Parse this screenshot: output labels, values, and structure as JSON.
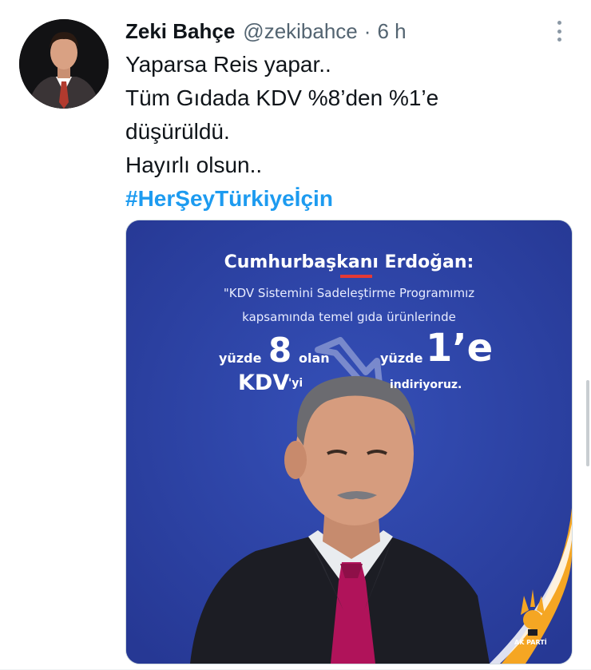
{
  "tweet": {
    "author_name": "Zeki Bahçe",
    "author_handle": "@zekibahce",
    "separator": "·",
    "time": "6 h",
    "lines": [
      "Yaparsa Reis yapar..",
      "Tüm Gıdada KDV %8’den %1’e",
      "düşürüldü.",
      "Hayırlı olsun.."
    ],
    "hashtag": "#HerŞeyTürkiyeİçin"
  },
  "media": {
    "title": "Cumhurbaşkanı Erdoğan:",
    "quote_line1": "\"KDV Sistemini Sadeleştirme Programımız",
    "quote_line2": "kapsamında temel gıda ürünlerinde",
    "left_prefix": "yüzde",
    "left_number": "8",
    "left_suffix": "olan",
    "left_bottom": "KDV",
    "left_bottom_suffix": "'yi",
    "right_prefix": "yüzde",
    "right_number": "1’e",
    "right_bottom": "indiriyoruz.",
    "logo_text": "AK PARTİ",
    "colors": {
      "background": "#2b3fa0",
      "accent": "#f5a623",
      "underline": "#e53935"
    }
  },
  "icons": {
    "more": "more-vertical-icon"
  }
}
